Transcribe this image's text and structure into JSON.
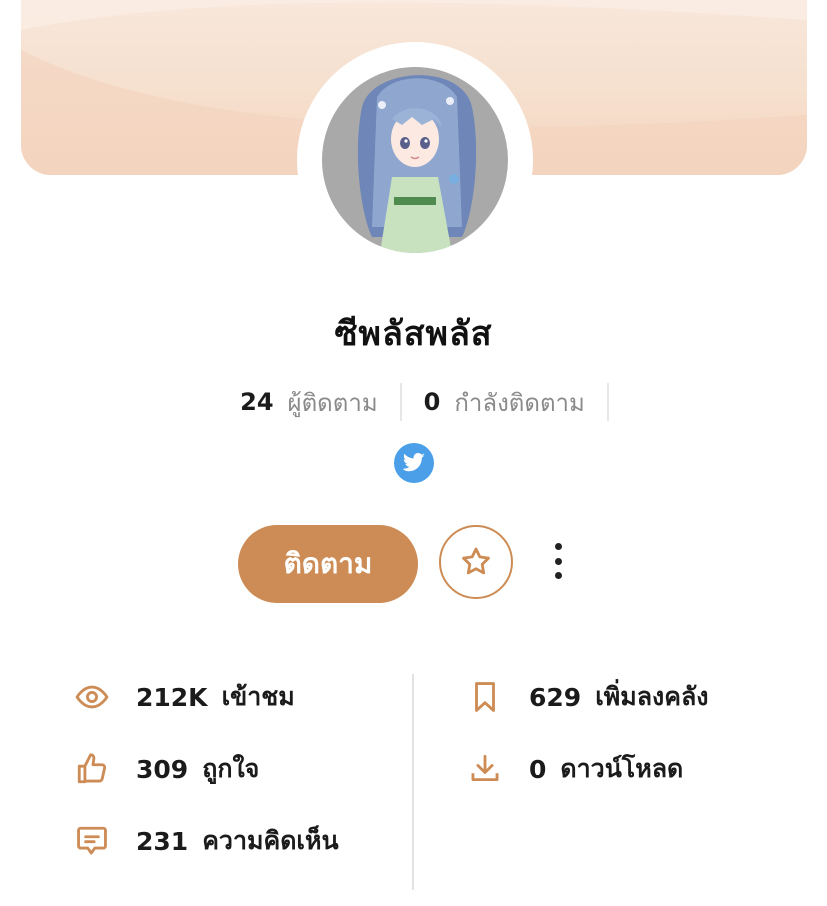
{
  "profile": {
    "name": "ซีพลัสพลัส",
    "followers_count": "24",
    "followers_label": "ผู้ติดตาม",
    "following_count": "0",
    "following_label": "กำลังติดตาม"
  },
  "social": {
    "twitter_icon": "twitter-icon"
  },
  "actions": {
    "follow_label": "ติดตาม",
    "favorite_icon": "star-icon",
    "more_icon": "more-vertical-icon"
  },
  "stats": {
    "views": {
      "value": "212K",
      "label": "เข้าชม",
      "icon": "eye-icon"
    },
    "likes": {
      "value": "309",
      "label": "ถูกใจ",
      "icon": "thumbs-up-icon"
    },
    "comments": {
      "value": "231",
      "label": "ความคิดเห็น",
      "icon": "comment-icon"
    },
    "library": {
      "value": "629",
      "label": "เพิ่มลงคลัง",
      "icon": "bookmark-icon"
    },
    "downloads": {
      "value": "0",
      "label": "ดาวน์โหลด",
      "icon": "download-icon"
    }
  },
  "colors": {
    "accent": "#cd8c55",
    "twitter": "#4a9fe8",
    "cover": "#f6dfcd",
    "text": "#1b1b1b",
    "muted": "#8a8a8a"
  }
}
